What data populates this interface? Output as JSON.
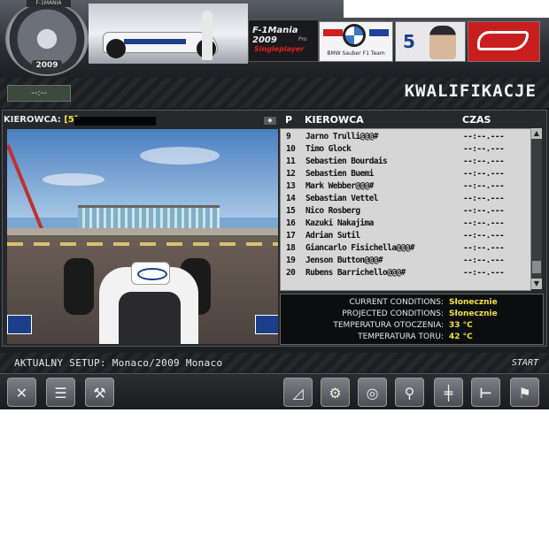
{
  "header": {
    "wheel_brand": "F-1MANIA",
    "wheel_year": "2009",
    "game_title": "F-1Mania 2009",
    "game_edition": "Pro",
    "game_mode": "Singleplayer",
    "team_name": "BMW Sauber F1 Team",
    "car_number": "5"
  },
  "subheader": {
    "lap_display": "--:--",
    "page_title": "KWALIFIKACJE"
  },
  "driver_bar": {
    "label": "KIEROWCA:",
    "value": "[5]"
  },
  "table": {
    "col_pos": "P",
    "col_driver": "KIEROWCA",
    "col_time": "CZAS",
    "rows": [
      {
        "pos": "9",
        "driver": "Jarno Trulli@@@#",
        "time": "--:--.---"
      },
      {
        "pos": "10",
        "driver": "Timo Glock",
        "time": "--:--.---"
      },
      {
        "pos": "11",
        "driver": "Sebastien Bourdais",
        "time": "--:--.---"
      },
      {
        "pos": "12",
        "driver": "Sebastien Buemi",
        "time": "--:--.---"
      },
      {
        "pos": "13",
        "driver": "Mark Webber@@@#",
        "time": "--:--.---"
      },
      {
        "pos": "14",
        "driver": "Sebastian Vettel",
        "time": "--:--.---"
      },
      {
        "pos": "15",
        "driver": "Nico Rosberg",
        "time": "--:--.---"
      },
      {
        "pos": "16",
        "driver": "Kazuki Nakajima",
        "time": "--:--.---"
      },
      {
        "pos": "17",
        "driver": "Adrian Sutil",
        "time": "--:--.---"
      },
      {
        "pos": "18",
        "driver": "Giancarlo Fisichella@@@#",
        "time": "--:--.---"
      },
      {
        "pos": "19",
        "driver": "Jenson Button@@@#",
        "time": "--:--.---"
      },
      {
        "pos": "20",
        "driver": "Rubens Barrichello@@@#",
        "time": "--:--.---"
      }
    ]
  },
  "conditions": {
    "current_label": "CURRENT CONDITIONS:",
    "current_value": "Słonecznie",
    "projected_label": "PROJECTED CONDITIONS:",
    "projected_value": "Słonecznie",
    "ambient_label": "TEMPERATURA OTOCZENIA:",
    "ambient_value": "33 °C",
    "track_label": "TEMPERATURA TORU:",
    "track_value": "42 °C"
  },
  "footer": {
    "setup_text": "AKTUALNY SETUP: Monaco/2009 Monaco",
    "start_label": "START"
  },
  "toolbar_icons": [
    "close-icon",
    "clipboard-icon",
    "pit-crew-icon",
    "graph-icon",
    "engine-icon",
    "tyre-icon",
    "wrench-icon",
    "gearbox-icon",
    "suspension-icon",
    "checkered-flag-icon"
  ],
  "colors": {
    "accent_yellow": "#f0e040",
    "bmw_blue": "#1d3f8a",
    "track_red": "#c81e1e"
  }
}
